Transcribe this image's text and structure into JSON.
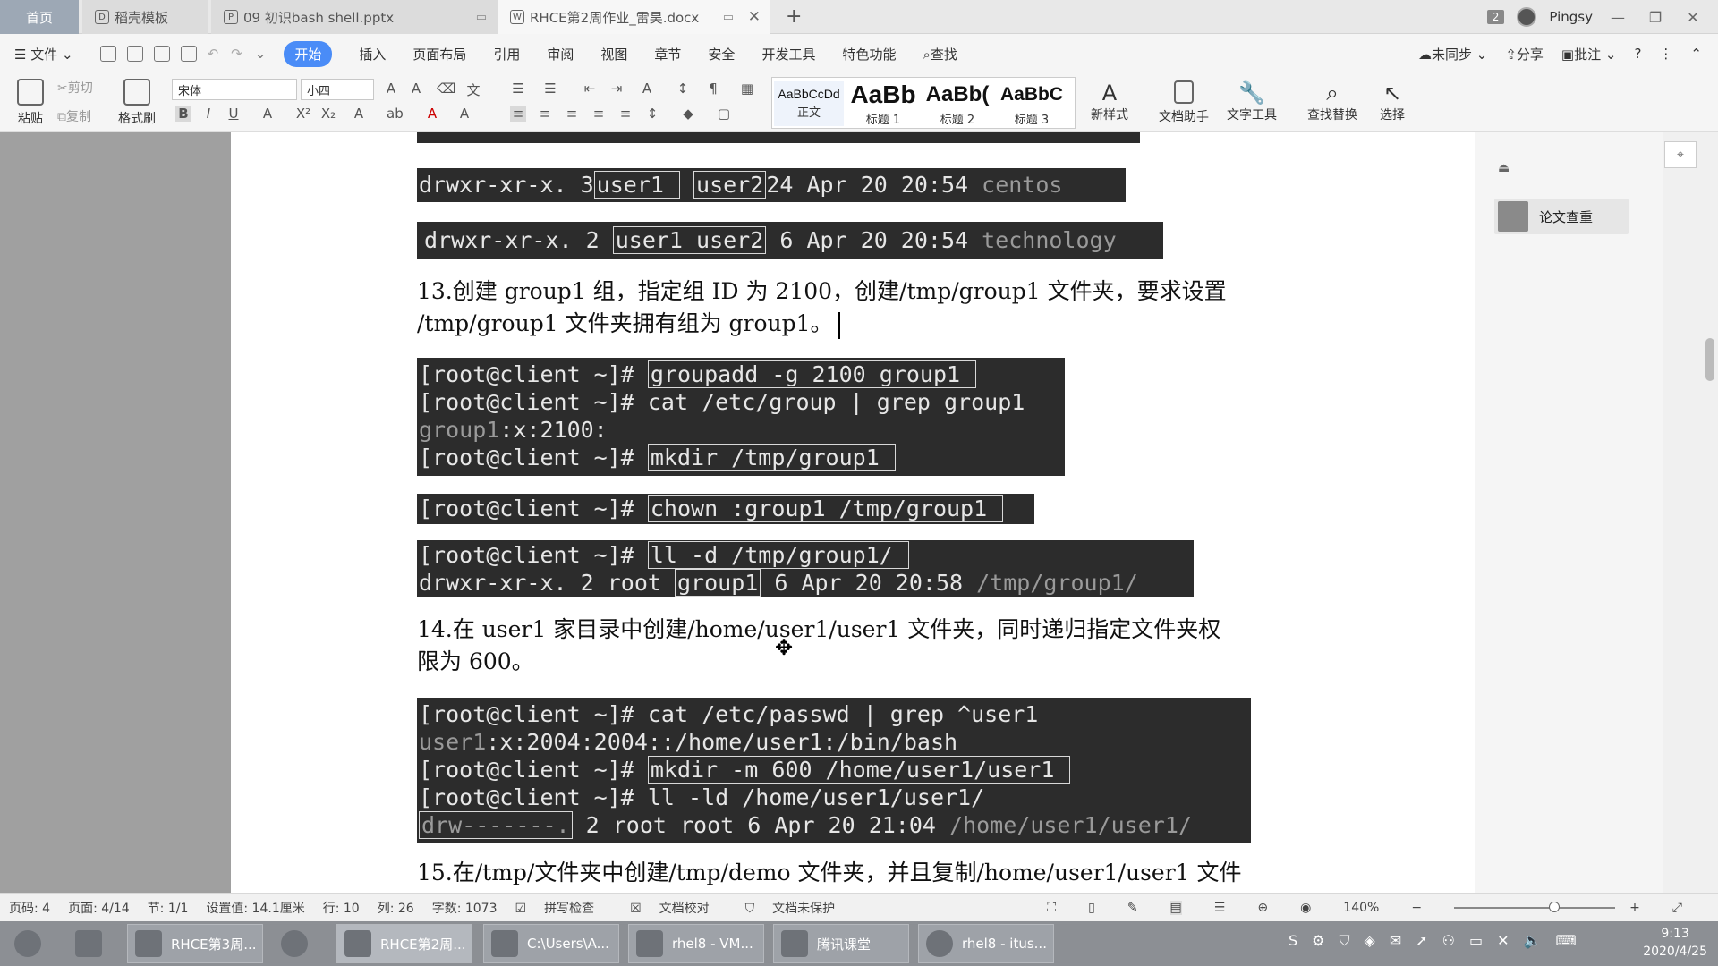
{
  "tabs": {
    "home": "首页",
    "t1": "稻壳模板",
    "t2": "09 初识bash shell.pptx",
    "t3": "RHCE第2周作业_雷昊.docx",
    "new": "+",
    "count": "2",
    "user": "Pingsy"
  },
  "menu": {
    "file": "文件",
    "items": [
      "开始",
      "插入",
      "页面布局",
      "引用",
      "审阅",
      "视图",
      "章节",
      "安全",
      "开发工具",
      "特色功能"
    ],
    "search": "查找",
    "sync": "未同步",
    "share": "分享",
    "comment": "批注"
  },
  "ribbon": {
    "paste": "粘贴",
    "cut": "剪切",
    "copy": "复制",
    "format_painter": "格式刷",
    "font": "宋体",
    "size": "小四",
    "styles": [
      {
        "preview": "AaBbCcDd",
        "label": "正文"
      },
      {
        "preview": "AaBb",
        "label": "标题 1"
      },
      {
        "preview": "AaBb(",
        "label": "标题 2"
      },
      {
        "preview": "AaBbC",
        "label": "标题 3"
      }
    ],
    "new_style": "新样式",
    "doc_helper": "文档助手",
    "text_tools": "文字工具",
    "find_replace": "查找替换",
    "select": "选择"
  },
  "doc": {
    "term_a": {
      "line1_perm": "drwxr-xr-x. 3",
      "u1": "user1 ",
      "u2": "user2",
      "rest": "24 Apr 20 20:54 ",
      "name": "centos"
    },
    "term_b": {
      "perm": "drwxr-xr-x. 2 ",
      "users": "user1 user2",
      "rest": " 6 Apr 20 20:54 ",
      "name": "technology"
    },
    "q13_line1": "13.创建 group1 组，指定组 ID 为 2100，创建/tmp/group1 文件夹，要求设置",
    "q13_line2": "/tmp/group1 文件夹拥有组为 group1。",
    "term_c": {
      "prompt": "[root@client ~]# ",
      "cmd1": "groupadd -g 2100 group1 ",
      "cmd2": "cat /etc/group | grep group1",
      "out_dim": "group1",
      "out_rest": ":x:2100:",
      "cmd3": "mkdir /tmp/group1 "
    },
    "term_d": {
      "prompt": "[root@client ~]# ",
      "cmd": "chown :group1 /tmp/group1 "
    },
    "term_e": {
      "prompt": "[root@client ~]# ",
      "cmd": "ll -d /tmp/group1/ ",
      "perm": "drwxr-xr-x. 2 root ",
      "grp": "group1",
      "rest": " 6 Apr 20 20:58 ",
      "path": "/tmp/group1/"
    },
    "q14_line1": "14.在 user1 家目录中创建/home/user1/user1 文件夹，同时递归指定文件夹权",
    "q14_line2": "限为 600。",
    "term_f": {
      "prompt": "[root@client ~]# ",
      "cmd1": "cat /etc/passwd | grep ^user1",
      "out_dim": "user1",
      "out_rest": ":x:2004:2004::/home/user1:/bin/bash",
      "cmd2": "mkdir -m 600 /home/user1/user1 ",
      "cmd3": "ll -ld /home/user1/user1/",
      "perm": "drw-------.",
      "rest": " 2 root root 6 Apr 20 21:04 ",
      "path": "/home/user1/user1/"
    },
    "q15_line1": "15.在/tmp/文件夹中创建/tmp/demo 文件夹，并且复制/home/user1/user1 文件"
  },
  "panel": {
    "paper_check": "论文查重"
  },
  "status": {
    "page_code": "页码: 4",
    "pages": "页面: 4/14",
    "section": "节: 1/1",
    "setting": "设置值: 14.1厘米",
    "row": "行: 10",
    "col": "列: 26",
    "words": "字数: 1073",
    "spell": "拼写检查",
    "proof": "文档校对",
    "protect": "文档未保护",
    "zoom": "140%",
    "zoom_level": 0.62
  },
  "taskbar": {
    "apps": [
      "RHCE第3周...",
      "RHCE第2周...",
      "C:\\Users\\A...",
      "rhel8 - VM...",
      "腾讯课堂",
      "rhel8 - itus..."
    ],
    "time": "9:13",
    "date": "2020/4/25"
  }
}
